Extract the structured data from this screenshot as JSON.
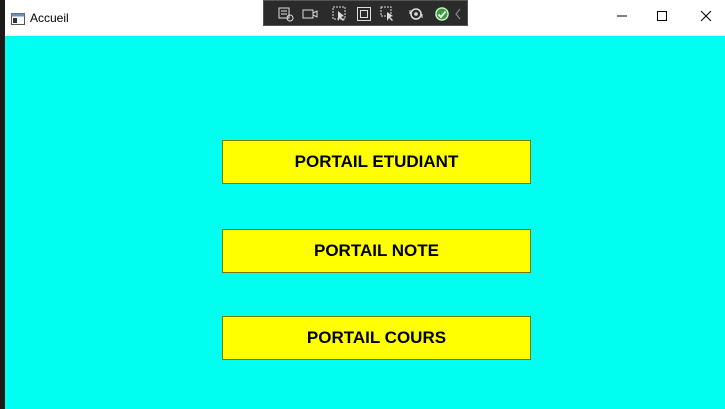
{
  "window": {
    "title": "Accueil",
    "icon": "app-window-icon"
  },
  "debug_toolbar": {
    "icons": [
      "live-visual-tree-icon",
      "video-capture-icon",
      "select-element-icon",
      "display-layout-adorners-icon",
      "track-focus-icon",
      "hot-reload-icon",
      "check-icon",
      "collapse-chevron-icon"
    ]
  },
  "main": {
    "buttons": [
      {
        "label": "PORTAIL ETUDIANT"
      },
      {
        "label": "PORTAIL NOTE"
      },
      {
        "label": "PORTAIL COURS"
      }
    ]
  },
  "colors": {
    "client_background": "#00fff0",
    "button_background": "#ffff00",
    "titlebar_background": "#ffffff"
  }
}
